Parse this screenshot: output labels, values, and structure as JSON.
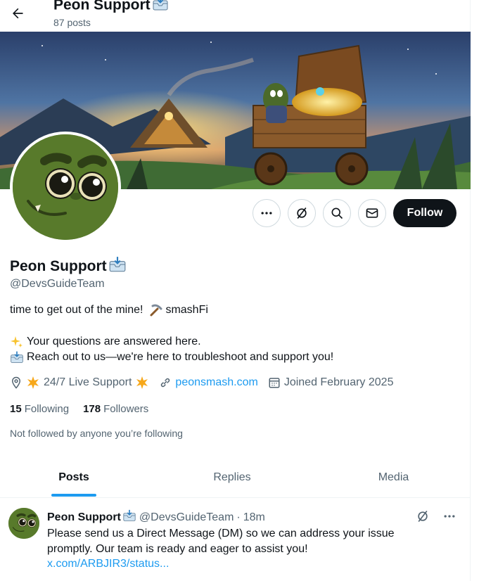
{
  "header": {
    "title": "Peon Support",
    "post_count": "87 posts"
  },
  "profile": {
    "name": "Peon Support",
    "handle": "@DevsGuideTeam",
    "bio_line1_text": "time to get out of the mine!",
    "bio_line1_suffix": "smashFi",
    "bio_line2": "Your questions are answered here.",
    "bio_line3": "Reach out to us—we're here to troubleshoot and support you!",
    "location": "24/7 Live Support",
    "website": "peonsmash.com",
    "joined": "Joined February 2025",
    "following_count": "15",
    "following_label": "Following",
    "followers_count": "178",
    "followers_label": "Followers",
    "followed_by": "Not followed by anyone you’re following"
  },
  "actions": {
    "follow_label": "Follow",
    "icons": [
      "more-icon",
      "grok-icon",
      "search-icon",
      "message-icon"
    ]
  },
  "tabs": [
    {
      "label": "Posts",
      "active": true
    },
    {
      "label": "Replies",
      "active": false
    },
    {
      "label": "Media",
      "active": false
    }
  ],
  "post": {
    "name": "Peon Support",
    "handle": "@DevsGuideTeam",
    "separator": "·",
    "time": "18m",
    "text": "Please send us a Direct Message (DM) so we can address your issue promptly. Our team is ready and eager to assist you!",
    "link": "x.com/ARBJIR3/status..."
  },
  "colors": {
    "accent": "#1d9bf0",
    "text": "#0f1419",
    "secondary": "#536471",
    "avatar_green": "#5a7a2c"
  }
}
